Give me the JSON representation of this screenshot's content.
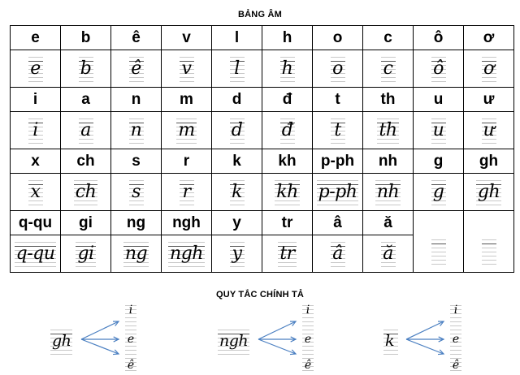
{
  "title": "BẢNG ÂM",
  "rows": [
    [
      "e",
      "b",
      "ê",
      "v",
      "l",
      "h",
      "o",
      "c",
      "ô",
      "ơ"
    ],
    [
      "i",
      "a",
      "n",
      "m",
      "d",
      "đ",
      "t",
      "th",
      "u",
      "ư"
    ],
    [
      "x",
      "ch",
      "s",
      "r",
      "k",
      "kh",
      "p-ph",
      "nh",
      "g",
      "gh"
    ],
    [
      "q-qu",
      "gi",
      "ng",
      "ngh",
      "y",
      "tr",
      "â",
      "ă",
      "",
      ""
    ]
  ],
  "rules_title": "QUY TẮC CHÍNH TẢ",
  "rules": [
    {
      "source": "gh",
      "targets": [
        "i",
        "e",
        "ê"
      ]
    },
    {
      "source": "ngh",
      "targets": [
        "i",
        "e",
        "ê"
      ]
    },
    {
      "source": "k",
      "targets": [
        "i",
        "e",
        "ê"
      ]
    }
  ]
}
